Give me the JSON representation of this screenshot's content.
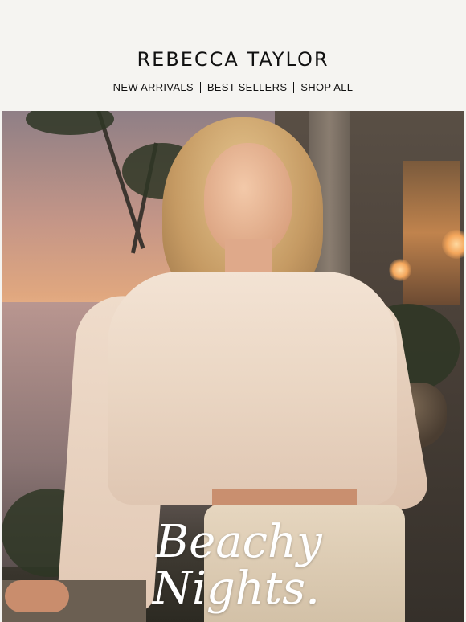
{
  "brand": {
    "name": "REBECCA TAYLOR"
  },
  "nav": {
    "items": [
      "NEW ARRIVALS",
      "BEST SELLERS",
      "SHOP ALL"
    ]
  },
  "hero": {
    "headline_line1": "Beachy",
    "headline_line2": "Nights."
  },
  "colors": {
    "background": "#f5f4f1",
    "text": "#111111",
    "headline": "#ffffff"
  }
}
